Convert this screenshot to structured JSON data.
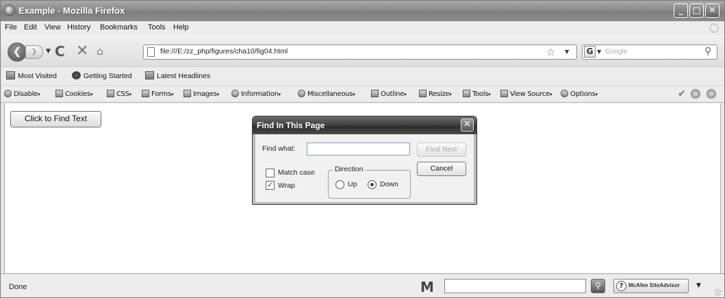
{
  "window": {
    "title": "Example - Mozilla Firefox"
  },
  "menu": {
    "file": "File",
    "edit": "Edit",
    "view": "View",
    "history": "History",
    "bookmarks": "Bookmarks",
    "tools": "Tools",
    "help": "Help"
  },
  "nav": {
    "url": "file:///E:/zz_php/figures/cha10/fig04.html",
    "search_placeholder": "Google"
  },
  "bookmarks_bar": {
    "items": [
      "Most Visited",
      "Getting Started",
      "Latest Headlines"
    ]
  },
  "devtoolbar": {
    "items": [
      "Disable",
      "Cookies",
      "CSS",
      "Forms",
      "Images",
      "Information",
      "Miscellaneous",
      "Outline",
      "Resize",
      "Tools",
      "View Source",
      "Options"
    ]
  },
  "page": {
    "button_label": "Click to Find Text"
  },
  "find_dialog": {
    "title": "Find In This Page",
    "find_what_label": "Find what:",
    "find_what_value": "",
    "find_next_label": "Find Next",
    "cancel_label": "Cancel",
    "match_case_label": "Match case",
    "match_case_checked": false,
    "wrap_label": "Wrap",
    "wrap_checked": true,
    "direction_label": "Direction",
    "up_label": "Up",
    "down_label": "Down",
    "direction_selected": "Down"
  },
  "statusbar": {
    "status": "Done",
    "siteadvisor_label": "McAfee SiteAdvisor"
  }
}
